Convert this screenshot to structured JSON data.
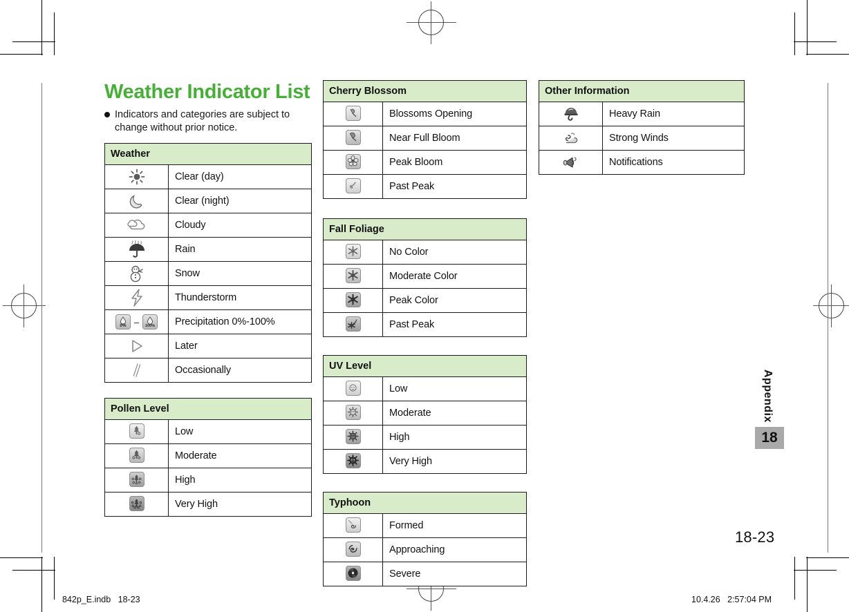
{
  "page": {
    "title": "Weather Indicator List",
    "note": "Indicators and categories are subject to change without prior notice.",
    "side_tab": "Appendix",
    "chapter_number": "18",
    "folio": "18-23",
    "footer_left": "842p_E.indb   18-23",
    "footer_right": "10.4.26   2:57:04 PM",
    "accent_color": "#45b035",
    "header_fill": "#d9ecc9",
    "chapter_box_fill": "#a9a9a9"
  },
  "tables": [
    {
      "id": "weather",
      "header": "Weather",
      "rows": [
        {
          "icon": "sun-icon",
          "label": "Clear (day)"
        },
        {
          "icon": "crescent-moon-icon",
          "label": "Clear (night)"
        },
        {
          "icon": "cloud-icon",
          "label": "Cloudy"
        },
        {
          "icon": "umbrella-rain-icon",
          "label": "Rain"
        },
        {
          "icon": "snowman-icon",
          "label": "Snow"
        },
        {
          "icon": "lightning-bolt-icon",
          "label": "Thunderstorm"
        },
        {
          "icon": "precipitation-range-icon",
          "label": "Precipitation 0%-100%",
          "icon_text_a": "0%",
          "icon_text_b": "100%",
          "icon_separator": "–"
        },
        {
          "icon": "play-triangle-icon",
          "label": "Later"
        },
        {
          "icon": "slash-icon",
          "label": "Occasionally"
        }
      ]
    },
    {
      "id": "pollen-level",
      "header": "Pollen Level",
      "rows": [
        {
          "icon": "pollen-low-icon",
          "label": "Low"
        },
        {
          "icon": "pollen-moderate-icon",
          "label": "Moderate"
        },
        {
          "icon": "pollen-high-icon",
          "label": "High"
        },
        {
          "icon": "pollen-very-high-icon",
          "label": "Very High"
        }
      ]
    },
    {
      "id": "cherry-blossom",
      "header": "Cherry Blossom",
      "rows": [
        {
          "icon": "blossom-bud-icon",
          "label": "Blossoms Opening"
        },
        {
          "icon": "blossom-near-full-icon",
          "label": "Near Full Bloom"
        },
        {
          "icon": "blossom-peak-icon",
          "label": "Peak Bloom"
        },
        {
          "icon": "blossom-past-peak-icon",
          "label": "Past Peak"
        }
      ]
    },
    {
      "id": "fall-foliage",
      "header": "Fall Foliage",
      "rows": [
        {
          "icon": "leaf-no-color-icon",
          "label": "No Color"
        },
        {
          "icon": "leaf-moderate-color-icon",
          "label": "Moderate Color"
        },
        {
          "icon": "leaf-peak-color-icon",
          "label": "Peak Color"
        },
        {
          "icon": "leaf-past-peak-icon",
          "label": "Past Peak"
        }
      ]
    },
    {
      "id": "uv-level",
      "header": "UV Level",
      "rows": [
        {
          "icon": "uv-low-icon",
          "label": "Low"
        },
        {
          "icon": "uv-moderate-icon",
          "label": "Moderate"
        },
        {
          "icon": "uv-high-icon",
          "label": "High"
        },
        {
          "icon": "uv-very-high-icon",
          "label": "Very High"
        }
      ]
    },
    {
      "id": "typhoon",
      "header": "Typhoon",
      "rows": [
        {
          "icon": "typhoon-formed-icon",
          "label": "Formed"
        },
        {
          "icon": "typhoon-approaching-icon",
          "label": "Approaching"
        },
        {
          "icon": "typhoon-severe-icon",
          "label": "Severe"
        }
      ]
    },
    {
      "id": "other-information",
      "header": "Other Information",
      "rows": [
        {
          "icon": "heavy-rain-icon",
          "label": "Heavy Rain"
        },
        {
          "icon": "strong-winds-icon",
          "label": "Strong Winds"
        },
        {
          "icon": "notifications-megaphone-icon",
          "label": "Notifications"
        }
      ]
    }
  ]
}
